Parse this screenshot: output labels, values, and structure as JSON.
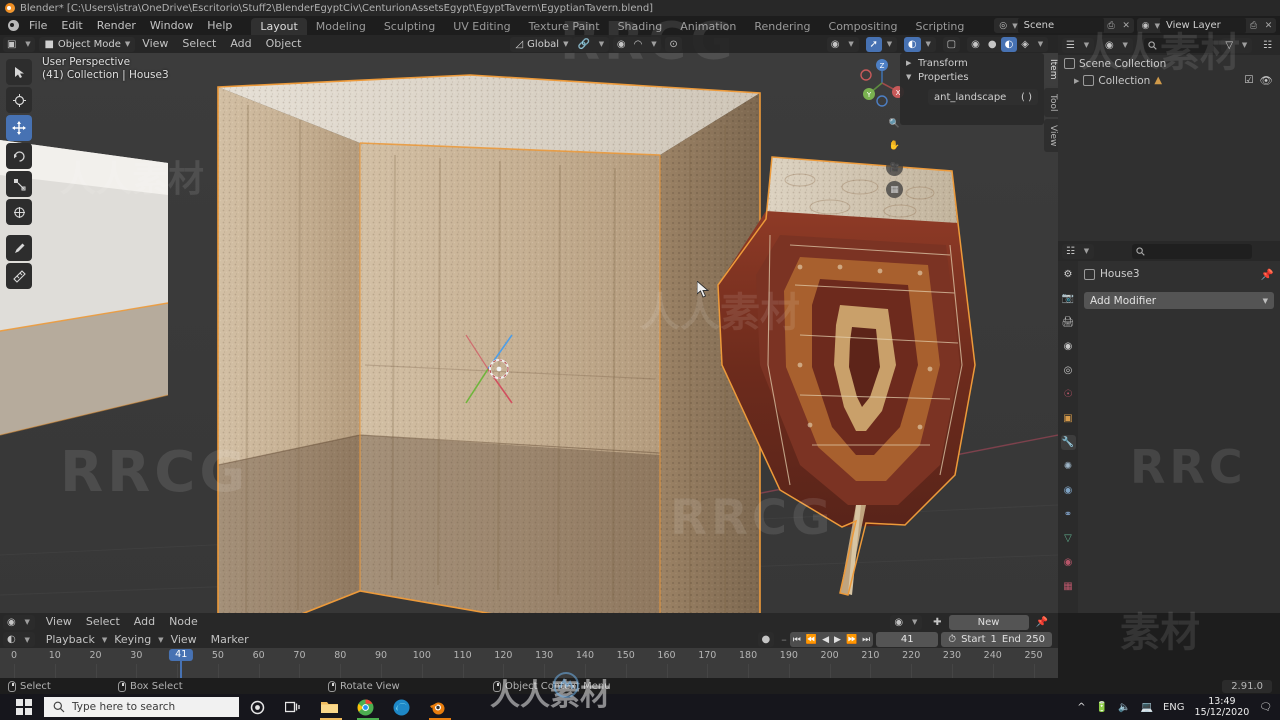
{
  "window": {
    "title": "Blender* [C:\\Users\\istra\\OneDrive\\Escritorio\\Stuff2\\BlenderEgyptCiv\\CenturionAssetsEgypt\\EgyptTavern\\EgyptianTavern.blend]"
  },
  "topbar": {
    "menus": [
      "File",
      "Edit",
      "Render",
      "Window",
      "Help"
    ],
    "workspace_tabs": [
      "Layout",
      "Modeling",
      "Sculpting",
      "UV Editing",
      "Texture Paint",
      "Shading",
      "Animation",
      "Rendering",
      "Compositing",
      "Scripting"
    ],
    "active_workspace": "Layout",
    "scene_name": "Scene",
    "view_layer_name": "View Layer"
  },
  "viewport": {
    "mode": "Object Mode",
    "menus": [
      "View",
      "Select",
      "Add",
      "Object"
    ],
    "transform_orientation": "Global",
    "overlay_line1": "User Perspective",
    "overlay_line2": "(41) Collection | House3",
    "gizmo_axes": [
      "X",
      "Y",
      "Z"
    ],
    "tools": [
      {
        "name": "tweak-tool",
        "glyph": "⬚"
      },
      {
        "name": "cursor-tool",
        "glyph": "⌖"
      },
      {
        "name": "move-tool",
        "glyph": "✛"
      },
      {
        "name": "rotate-tool",
        "glyph": "↻"
      },
      {
        "name": "scale-tool",
        "glyph": "⤡"
      },
      {
        "name": "transform-tool",
        "glyph": "✥"
      },
      {
        "name": "annotate-tool",
        "glyph": "✎"
      },
      {
        "name": "measure-tool",
        "glyph": "↗"
      }
    ],
    "active_tool_index": 2,
    "side_tabs": [
      "Item",
      "Tool",
      "View"
    ],
    "active_side_tab": "Item"
  },
  "npanel": {
    "sections": [
      {
        "label": "Transform",
        "expanded": false
      },
      {
        "label": "Properties",
        "expanded": true
      }
    ],
    "custom_property_name": "ant_landscape",
    "custom_property_value": "( )"
  },
  "outliner": {
    "search_placeholder": "",
    "rows": [
      {
        "label": "Scene Collection",
        "indent": 0
      },
      {
        "label": "Collection",
        "indent": 1
      }
    ]
  },
  "properties_editor": {
    "breadcrumb_object": "House3",
    "add_modifier_label": "Add Modifier",
    "tabs": [
      "tool-tab",
      "render-tab",
      "output-tab",
      "view-layer-tab",
      "scene-tab",
      "world-tab",
      "object-tab",
      "modifier-tab",
      "particles-tab",
      "physics-tab",
      "constraints-tab",
      "data-tab",
      "material-tab",
      "texture-tab"
    ],
    "active_tab": "modifier-tab"
  },
  "shader_editor": {
    "menus": [
      "View",
      "Select",
      "Add",
      "Node"
    ],
    "new_button_label": "New"
  },
  "timeline": {
    "menus": [
      "Playback",
      "Keying",
      "View",
      "Marker"
    ],
    "current_frame": "41",
    "start_label": "Start",
    "start_value": "1",
    "end_label": "End",
    "end_value": "250",
    "ticks": [
      0,
      10,
      20,
      30,
      40,
      50,
      60,
      70,
      80,
      90,
      100,
      110,
      120,
      130,
      140,
      150,
      160,
      170,
      180,
      190,
      200,
      210,
      220,
      230,
      240,
      250
    ],
    "range_min": 0,
    "range_max": 256
  },
  "statusbar": {
    "hints": [
      {
        "label": "Select",
        "mouse": "left"
      },
      {
        "label": "Box Select",
        "mouse": "left-drag"
      },
      {
        "label": "Rotate View",
        "mouse": "middle"
      },
      {
        "label": "Object Context Menu",
        "mouse": "right"
      }
    ],
    "version": "2.91.0"
  },
  "taskbar": {
    "search_placeholder": "Type here to search",
    "apps": [
      "cortana-icon",
      "task-view-icon",
      "file-explorer-icon",
      "chrome-icon",
      "edge-icon",
      "blender-icon"
    ],
    "language": "ENG",
    "time": "13:49",
    "date": "15/12/2020"
  },
  "colors": {
    "accent_blue": "#4772b3",
    "selection_orange": "#ed9a3a",
    "header_bg": "#282828",
    "editor_bg": "#303030",
    "viewport_bg": "#393939",
    "taskbar_bg": "#16161c"
  },
  "watermarks": [
    "RRCG",
    "人人素材"
  ]
}
